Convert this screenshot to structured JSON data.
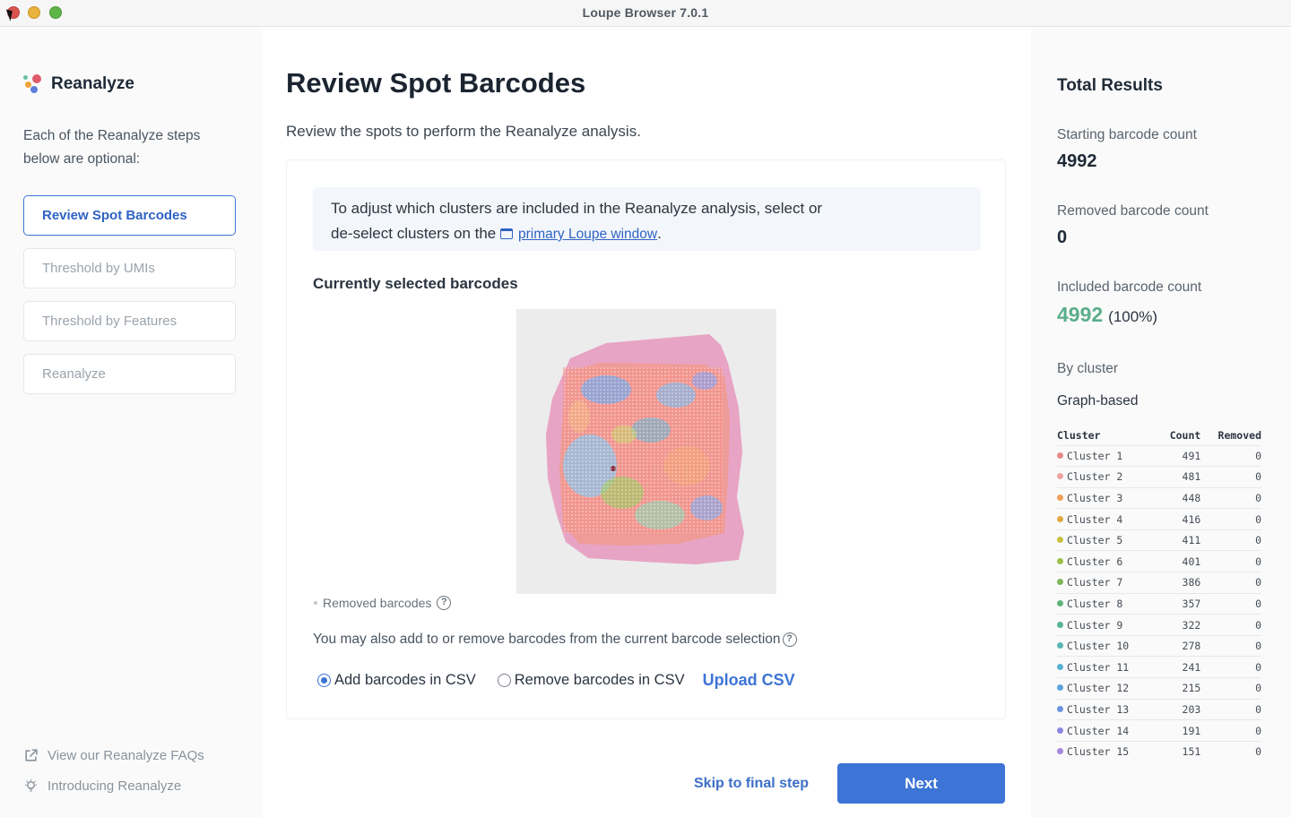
{
  "window": {
    "title": "Loupe Browser 7.0.1"
  },
  "sidebar": {
    "brand": "Reanalyze",
    "intro": "Each of the Reanalyze steps below are optional:",
    "steps": [
      {
        "label": "Review Spot Barcodes",
        "active": true
      },
      {
        "label": "Threshold by UMIs",
        "active": false
      },
      {
        "label": "Threshold by Features",
        "active": false
      },
      {
        "label": "Reanalyze",
        "active": false
      }
    ],
    "links": [
      {
        "label": "View our Reanalyze FAQs",
        "icon": "external-link-icon"
      },
      {
        "label": "Introducing Reanalyze",
        "icon": "lightbulb-icon"
      }
    ]
  },
  "main": {
    "title": "Review Spot Barcodes",
    "subtitle": "Review the spots to perform the Reanalyze analysis.",
    "info_line1": "To adjust which clusters are included in the Reanalyze analysis, select or",
    "info_line2_prefix": "de-select clusters on the",
    "info_link": "primary Loupe window",
    "info_suffix": ".",
    "selected_title": "Currently selected barcodes",
    "removed_label": "Removed barcodes",
    "may_also": "You may also add to or remove barcodes from the current barcode selection",
    "radio_add": "Add barcodes in CSV",
    "radio_remove": "Remove barcodes in CSV",
    "upload": "Upload CSV",
    "skip": "Skip to final step",
    "next": "Next"
  },
  "results": {
    "title": "Total Results",
    "starting_label": "Starting barcode count",
    "starting_value": "4992",
    "removed_label": "Removed barcode count",
    "removed_value": "0",
    "included_label": "Included barcode count",
    "included_value": "4992",
    "included_pct": "(100%)",
    "by_cluster": "By cluster",
    "clustering": "Graph-based",
    "table_headers": {
      "cluster": "Cluster",
      "count": "Count",
      "removed": "Removed"
    },
    "clusters": [
      {
        "name": "Cluster 1",
        "count": "491",
        "removed": "0",
        "color": "#e88a8a"
      },
      {
        "name": "Cluster 2",
        "count": "481",
        "removed": "0",
        "color": "#f0a3a3"
      },
      {
        "name": "Cluster 3",
        "count": "448",
        "removed": "0",
        "color": "#f0a05a"
      },
      {
        "name": "Cluster 4",
        "count": "416",
        "removed": "0",
        "color": "#e0a840"
      },
      {
        "name": "Cluster 5",
        "count": "411",
        "removed": "0",
        "color": "#c9c040"
      },
      {
        "name": "Cluster 6",
        "count": "401",
        "removed": "0",
        "color": "#9cbf4a"
      },
      {
        "name": "Cluster 7",
        "count": "386",
        "removed": "0",
        "color": "#7db55a"
      },
      {
        "name": "Cluster 8",
        "count": "357",
        "removed": "0",
        "color": "#5fb47a"
      },
      {
        "name": "Cluster 9",
        "count": "322",
        "removed": "0",
        "color": "#58b497"
      },
      {
        "name": "Cluster 10",
        "count": "278",
        "removed": "0",
        "color": "#5ab6b2"
      },
      {
        "name": "Cluster 11",
        "count": "241",
        "removed": "0",
        "color": "#57b2cf"
      },
      {
        "name": "Cluster 12",
        "count": "215",
        "removed": "0",
        "color": "#5aa4e0"
      },
      {
        "name": "Cluster 13",
        "count": "203",
        "removed": "0",
        "color": "#6c93e2"
      },
      {
        "name": "Cluster 14",
        "count": "191",
        "removed": "0",
        "color": "#8c88e0"
      },
      {
        "name": "Cluster 15",
        "count": "151",
        "removed": "0",
        "color": "#a487dc"
      }
    ]
  },
  "colors": {
    "accent": "#3d74d6",
    "included": "#5bae8c"
  }
}
